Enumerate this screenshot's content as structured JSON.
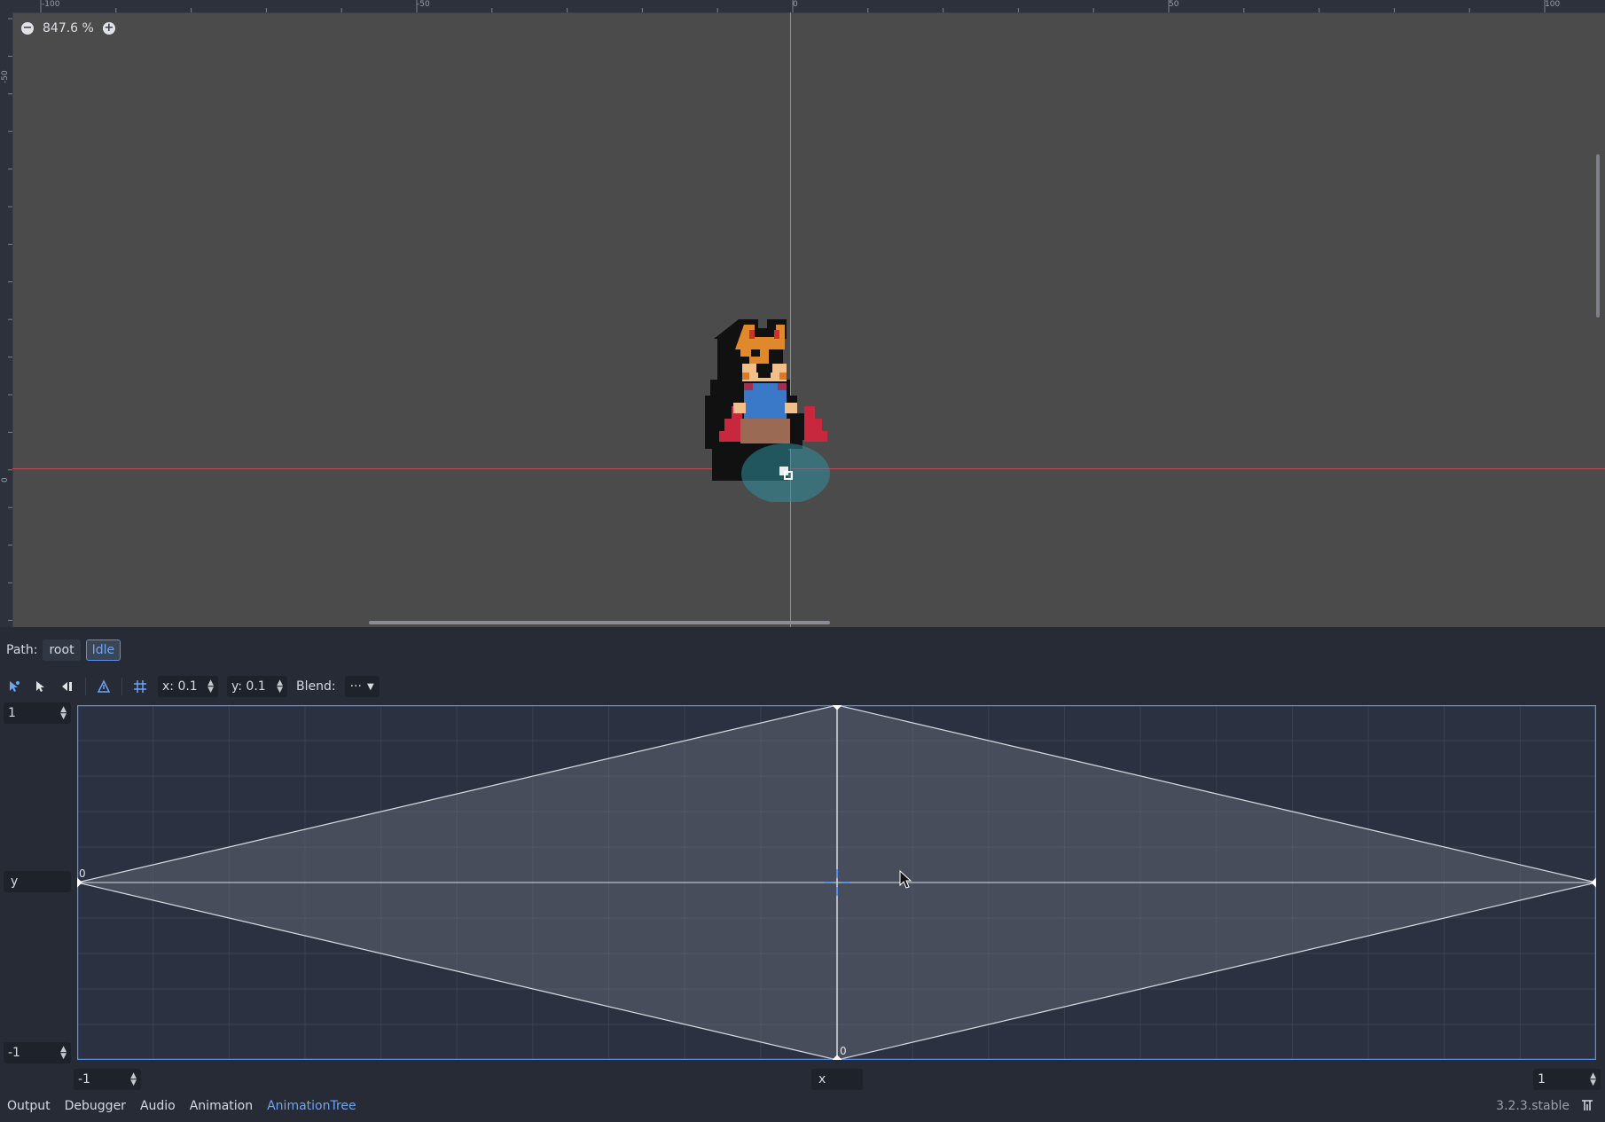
{
  "viewport": {
    "zoom_level": "847.6 %",
    "zoom_out_icon": "minus-circle-icon",
    "zoom_in_icon": "plus-circle-icon",
    "ruler_top_labels": [
      "-100",
      "-50",
      "0",
      "50",
      "100"
    ],
    "ruler_left_labels": [
      "-50",
      "0"
    ],
    "sprite": "fox-character-sprite"
  },
  "path_bar": {
    "label": "Path:",
    "items": [
      {
        "label": "root",
        "active": false
      },
      {
        "label": "Idle",
        "active": true
      }
    ]
  },
  "toolbar": {
    "tools": [
      "select-points-icon",
      "create-points-icon",
      "erase-points-icon",
      "create-triangles-icon",
      "snap-grid-icon"
    ],
    "snap_x": "x: 0.1",
    "snap_y": "y: 0.1",
    "blend_label": "Blend:",
    "blend_value": "···"
  },
  "blend_space": {
    "max_y": "1",
    "y_label": "y",
    "min_y": "-1",
    "min_x": "-1",
    "x_label": "x",
    "max_x": "1",
    "point_label_left": "0",
    "point_label_bottom": "0"
  },
  "bottom_tabs": [
    {
      "label": "Output",
      "active": false
    },
    {
      "label": "Debugger",
      "active": false
    },
    {
      "label": "Audio",
      "active": false
    },
    {
      "label": "Animation",
      "active": false
    },
    {
      "label": "AnimationTree",
      "active": true
    }
  ],
  "version": "3.2.3.stable",
  "pin_icon": "pin-icon",
  "colors": {
    "accent": "#6fa4f2",
    "viewport_bg": "#4b4b4b",
    "panel_bg": "#262b36",
    "y_axis": "#7aa83a",
    "x_axis": "#b84a5a"
  }
}
